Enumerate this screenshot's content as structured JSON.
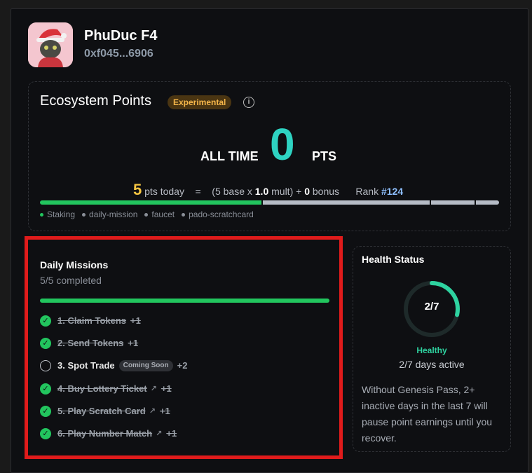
{
  "profile": {
    "name": "PhuDuc F4",
    "address": "0xf045...6906"
  },
  "points": {
    "title": "Ecosystem Points",
    "badge": "Experimental",
    "info_glyph": "i",
    "alltime_label": "ALL TIME",
    "alltime_value": "0",
    "pts_label": "PTS",
    "today_value": "5",
    "today_label": "pts today",
    "equals": "=",
    "base_text": "(5 base x",
    "mult_value": "1.0",
    "mult_text": "mult) +",
    "bonus_value": "0",
    "bonus_text": "bonus",
    "rank_label": "Rank",
    "rank_value": "#124",
    "progress_segments": [
      {
        "source": "Staking",
        "color": "#22c55e",
        "fraction": 0.486
      },
      {
        "source": "daily-mission",
        "color": "#b6bcc6",
        "fraction": 0.366
      },
      {
        "source": "faucet",
        "color": "#b6bcc6",
        "fraction": 0.098
      },
      {
        "source": "pado-scratchcard",
        "color": "#b6bcc6",
        "fraction": 0.05
      }
    ],
    "legend": [
      {
        "label": "Staking",
        "color": "#22c55e"
      },
      {
        "label": "daily-mission",
        "color": "#8a8f98"
      },
      {
        "label": "faucet",
        "color": "#8a8f98"
      },
      {
        "label": "pado-scratchcard",
        "color": "#8a8f98"
      }
    ]
  },
  "missions": {
    "title": "Daily Missions",
    "completed_text": "5/5 completed",
    "progress": 1.0,
    "items": [
      {
        "label": "1. Claim Tokens",
        "bonus": "+1",
        "done": true,
        "external": false
      },
      {
        "label": "2. Send Tokens",
        "bonus": "+1",
        "done": true,
        "external": false
      },
      {
        "label": "3. Spot Trade",
        "bonus": "+2",
        "done": false,
        "external": false,
        "badge": "Coming Soon"
      },
      {
        "label": "4. Buy Lottery Ticket",
        "bonus": "+1",
        "done": true,
        "external": true
      },
      {
        "label": "5. Play Scratch Card",
        "bonus": "+1",
        "done": true,
        "external": true
      },
      {
        "label": "6. Play Number Match",
        "bonus": "+1",
        "done": true,
        "external": true
      }
    ]
  },
  "health": {
    "title": "Health Status",
    "fraction_text": "2/7",
    "fraction_value": 0.2857,
    "state": "Healthy",
    "days_active": "2/7 days active",
    "note": "Without Genesis Pass, 2+ inactive days in the last 7 will pause point earnings until you recover.",
    "ring_color": "#2ed3a0",
    "track_color": "#1e2a2a"
  }
}
